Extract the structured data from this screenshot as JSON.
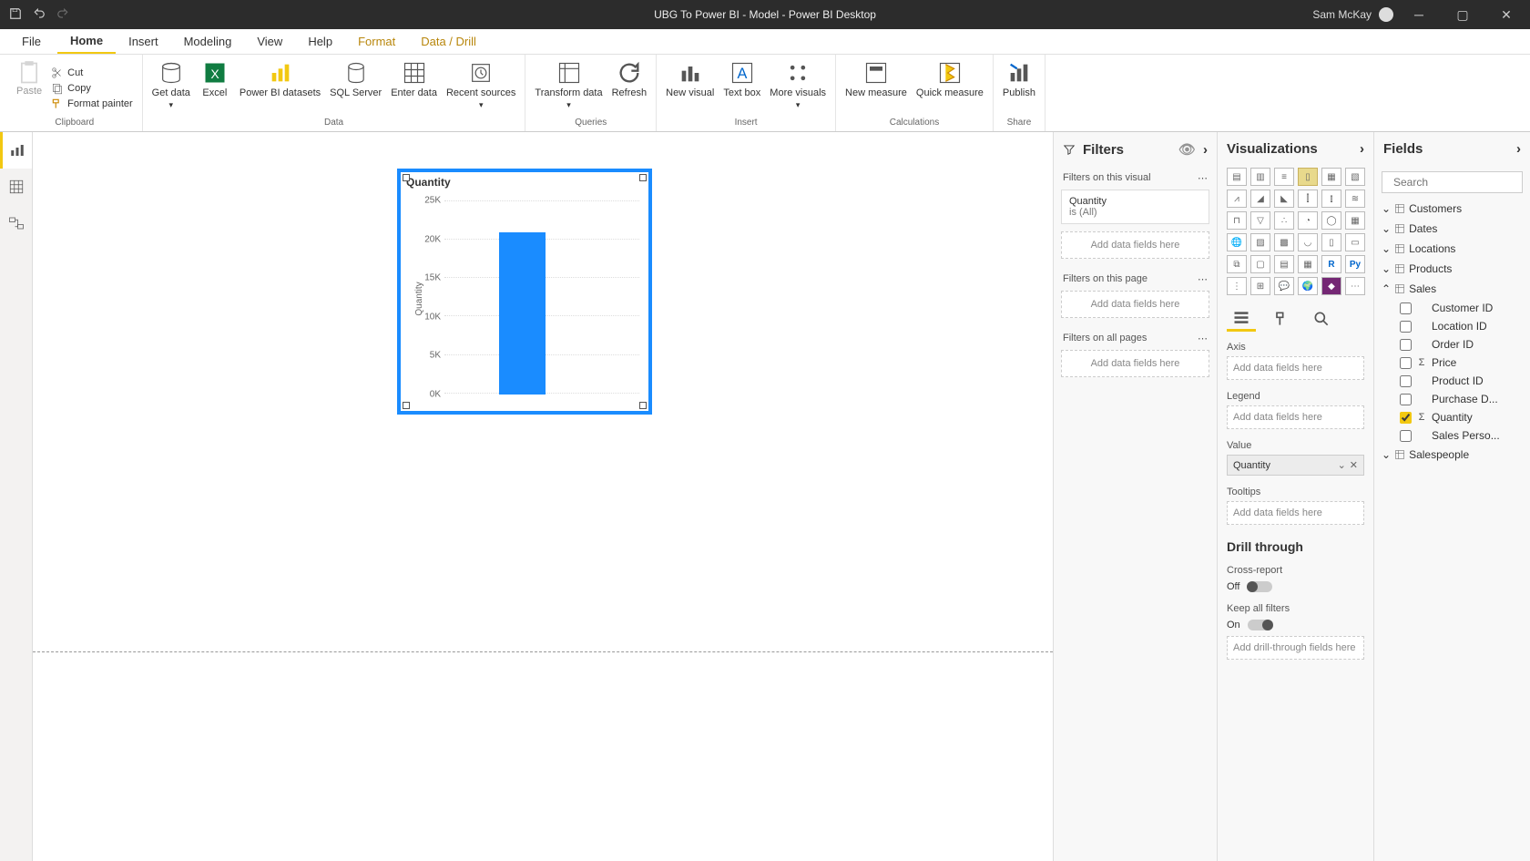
{
  "titlebar": {
    "title": "UBG To Power BI - Model - Power BI Desktop",
    "user": "Sam McKay"
  },
  "menu": {
    "file": "File",
    "tabs": [
      "Home",
      "Insert",
      "Modeling",
      "View",
      "Help",
      "Format",
      "Data / Drill"
    ],
    "active": "Home"
  },
  "ribbon": {
    "clipboard": {
      "paste": "Paste",
      "cut": "Cut",
      "copy": "Copy",
      "format_painter": "Format painter",
      "label": "Clipboard"
    },
    "data": {
      "get_data": "Get data",
      "excel": "Excel",
      "pbi_datasets": "Power BI datasets",
      "sql": "SQL Server",
      "enter": "Enter data",
      "recent": "Recent sources",
      "label": "Data"
    },
    "queries": {
      "transform": "Transform data",
      "refresh": "Refresh",
      "label": "Queries"
    },
    "insert": {
      "new_visual": "New visual",
      "text_box": "Text box",
      "more_visuals": "More visuals",
      "label": "Insert"
    },
    "calculations": {
      "new_measure": "New measure",
      "quick_measure": "Quick measure",
      "label": "Calculations"
    },
    "share": {
      "publish": "Publish",
      "label": "Share"
    }
  },
  "visual": {
    "title": "Quantity",
    "y_axis_label": "Quantity",
    "y_ticks": [
      "25K",
      "20K",
      "15K",
      "10K",
      "5K",
      "0K"
    ]
  },
  "chart_data": {
    "type": "bar",
    "categories": [
      ""
    ],
    "values": [
      21000
    ],
    "title": "Quantity",
    "xlabel": "",
    "ylabel": "Quantity",
    "ylim": [
      0,
      25000
    ]
  },
  "filters": {
    "header": "Filters",
    "on_visual": "Filters on this visual",
    "quantity_name": "Quantity",
    "quantity_state": "is (All)",
    "add_fields": "Add data fields here",
    "on_page": "Filters on this page",
    "on_all": "Filters on all pages"
  },
  "viz": {
    "header": "Visualizations",
    "axis": "Axis",
    "legend": "Legend",
    "value": "Value",
    "value_field": "Quantity",
    "tooltips": "Tooltips",
    "add_fields": "Add data fields here",
    "drill": "Drill through",
    "cross_report": "Cross-report",
    "cross_state": "Off",
    "keep_filters": "Keep all filters",
    "keep_state": "On",
    "add_drill": "Add drill-through fields here"
  },
  "fields": {
    "header": "Fields",
    "search_placeholder": "Search",
    "tables": [
      "Customers",
      "Dates",
      "Locations",
      "Products"
    ],
    "sales_table": "Sales",
    "sales_fields": [
      {
        "name": "Customer ID",
        "checked": false,
        "sigma": false
      },
      {
        "name": "Location ID",
        "checked": false,
        "sigma": false
      },
      {
        "name": "Order ID",
        "checked": false,
        "sigma": false
      },
      {
        "name": "Price",
        "checked": false,
        "sigma": true
      },
      {
        "name": "Product ID",
        "checked": false,
        "sigma": false
      },
      {
        "name": "Purchase D...",
        "checked": false,
        "sigma": false
      },
      {
        "name": "Quantity",
        "checked": true,
        "sigma": true
      },
      {
        "name": "Sales Perso...",
        "checked": false,
        "sigma": false
      }
    ],
    "salespeople_table": "Salespeople"
  }
}
